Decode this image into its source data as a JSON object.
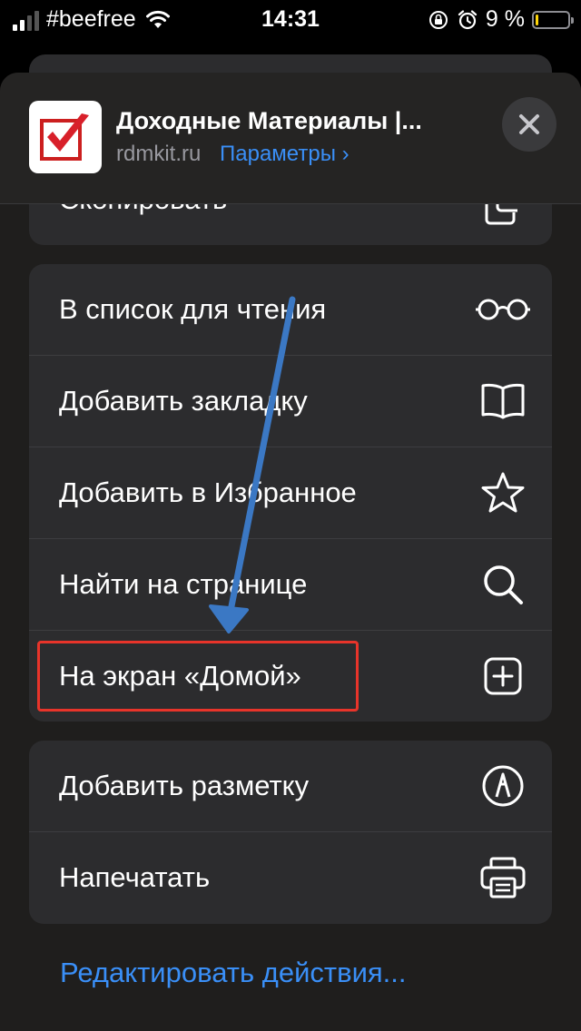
{
  "status_bar": {
    "carrier": "#beefree",
    "time": "14:31",
    "battery_percent": "9 %",
    "battery_level": 0.09,
    "signal_bars": 4,
    "signal_bars_active": 2
  },
  "share_sheet": {
    "site_title": "Доходные Материалы |...",
    "site_url": "rdmkit.ru",
    "options_label": "Параметры",
    "options_chevron": "›",
    "copy_label": "Скопировать",
    "groups": [
      {
        "items": [
          {
            "label": "В список для чтения",
            "icon": "glasses-icon"
          },
          {
            "label": "Добавить закладку",
            "icon": "book-icon"
          },
          {
            "label": "Добавить в Избранное",
            "icon": "star-icon"
          },
          {
            "label": "Найти на странице",
            "icon": "magnifier-icon"
          },
          {
            "label": "На экран «Домой»",
            "icon": "plus-square-icon"
          }
        ]
      },
      {
        "items": [
          {
            "label": "Добавить разметку",
            "icon": "markup-icon"
          },
          {
            "label": "Напечатать",
            "icon": "printer-icon"
          }
        ]
      }
    ],
    "edit_actions": "Редактировать действия..."
  },
  "colors": {
    "accent": "#3a8ff7",
    "highlight": "#e8342a",
    "annotation_arrow": "#3b78c4",
    "row_background": "#2c2c2e",
    "battery": "#ffd60a"
  }
}
